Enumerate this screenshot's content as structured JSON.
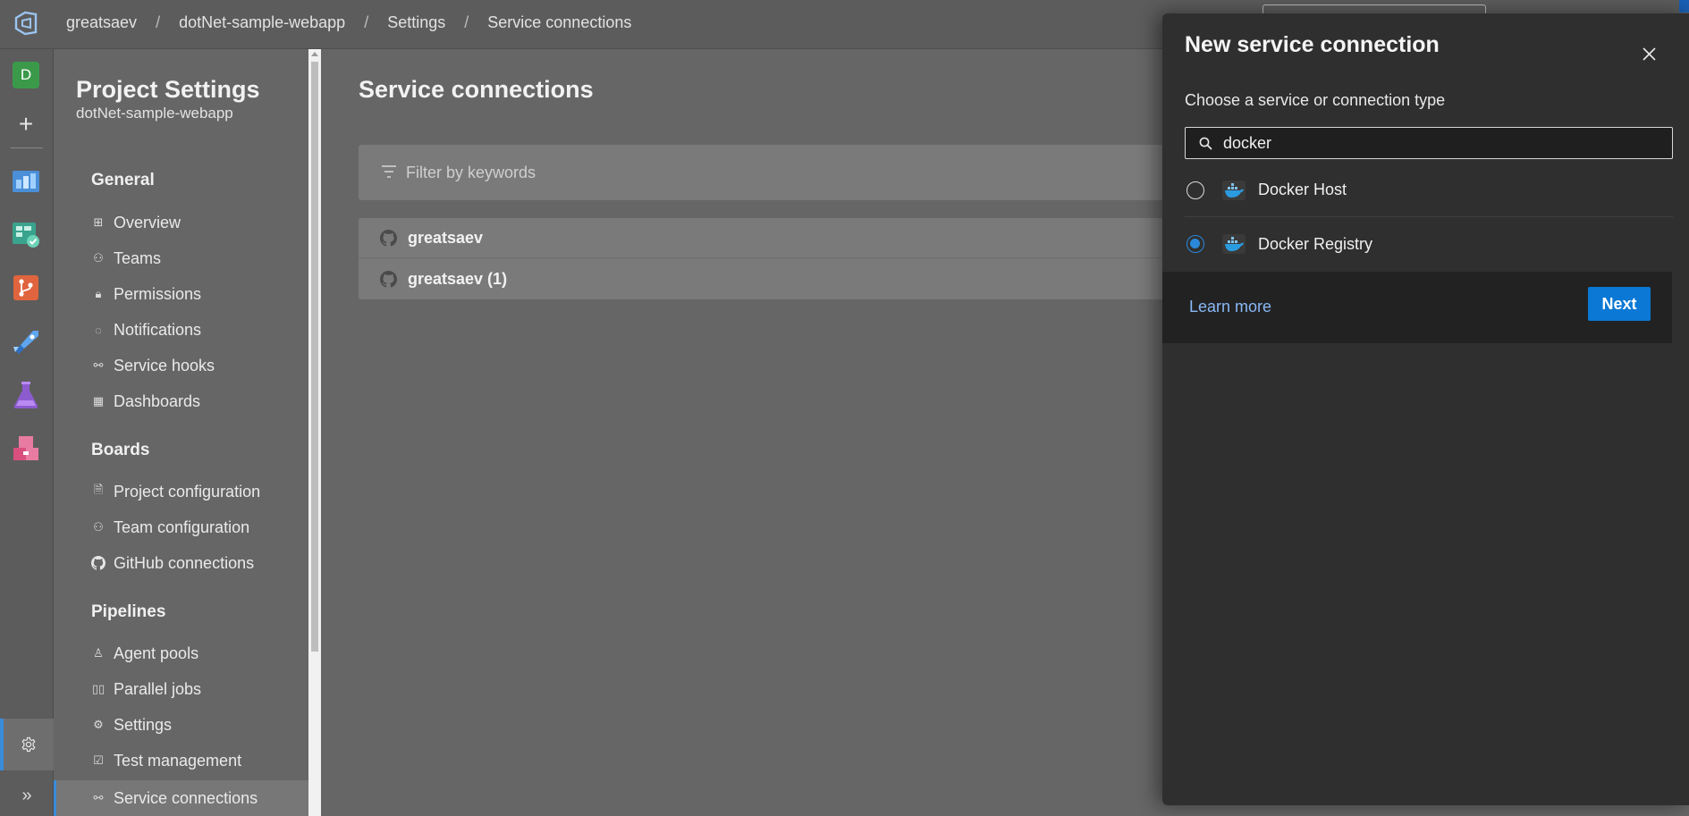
{
  "breadcrumb": {
    "items": [
      "greatsaev",
      "dotNet-sample-webapp",
      "Settings",
      "Service connections"
    ],
    "separator": "/"
  },
  "rail": {
    "avatar_letter": "D",
    "accent_color": "#3a8bd8",
    "icons": [
      "azure-devops-logo",
      "plus-icon",
      "overview-icon",
      "boards-icon",
      "repos-icon",
      "pipelines-icon",
      "test-plans-icon",
      "artifacts-icon",
      "gear-icon",
      "chevron-double-right-icon"
    ]
  },
  "settings_panel": {
    "title": "Project Settings",
    "subtitle": "dotNet-sample-webapp",
    "sections": [
      {
        "heading": "General",
        "items": [
          "Overview",
          "Teams",
          "Permissions",
          "Notifications",
          "Service hooks",
          "Dashboards"
        ]
      },
      {
        "heading": "Boards",
        "items": [
          "Project configuration",
          "Team configuration",
          "GitHub connections"
        ]
      },
      {
        "heading": "Pipelines",
        "items": [
          "Agent pools",
          "Parallel jobs",
          "Settings",
          "Test management",
          "Service connections"
        ]
      }
    ],
    "active_item": "Service connections"
  },
  "main": {
    "title": "Service connections",
    "filter_placeholder": "Filter by keywords",
    "connections": [
      "greatsaev",
      "greatsaev (1)"
    ]
  },
  "dialog": {
    "title": "New service connection",
    "label": "Choose a service or connection type",
    "search_value": "docker",
    "options": [
      {
        "label": "Docker Host",
        "selected": false
      },
      {
        "label": "Docker Registry",
        "selected": true
      }
    ],
    "learn_more": "Learn more",
    "next_label": "Next",
    "primary_color": "#0a78d4",
    "link_color": "#8ab8f5"
  }
}
